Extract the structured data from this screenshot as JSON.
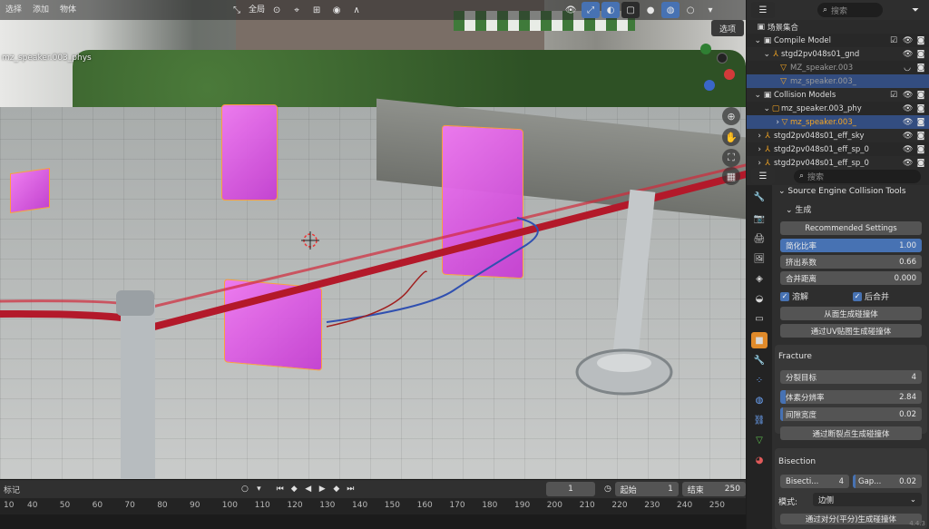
{
  "header": {
    "menu": [
      "选择",
      "添加",
      "物体"
    ],
    "orientation_label": "全局",
    "options_label": "选项"
  },
  "viewport": {
    "object_label": "mz_speaker.003_phys"
  },
  "outliner": {
    "search_placeholder": "搜索",
    "rows": [
      {
        "name": "场景集合",
        "kind": "scene"
      },
      {
        "name": "Compile Model",
        "kind": "collection"
      },
      {
        "name": "stgd2pv048s01_gnd",
        "kind": "object"
      },
      {
        "name": "MZ_speaker.003",
        "kind": "mesh"
      },
      {
        "name": "mz_speaker.003_",
        "kind": "mesh"
      },
      {
        "name": "Collision Models",
        "kind": "collection"
      },
      {
        "name": "mz_speaker.003_phy",
        "kind": "object"
      },
      {
        "name": "mz_speaker.003_",
        "kind": "mesh"
      },
      {
        "name": "stgd2pv048s01_eff_sky",
        "kind": "object"
      },
      {
        "name": "stgd2pv048s01_eff_sp_0",
        "kind": "object"
      },
      {
        "name": "stgd2pv048s01_eff_sp_0",
        "kind": "object"
      }
    ]
  },
  "properties": {
    "search_placeholder": "搜索",
    "panel_title": "Source Engine Collision Tools",
    "generate_label": "生成",
    "recommended_label": "Recommended Settings",
    "simplify": {
      "label": "简化比率",
      "value": "1.00",
      "fraction": 1.0
    },
    "extrude": {
      "label": "挤出系数",
      "value": "0.66"
    },
    "merge": {
      "label": "合并距离",
      "value": "0.000"
    },
    "dissolve_label": "溶解",
    "merge_after_label": "后合并",
    "from_faces_label": "从面生成碰撞体",
    "from_uv_label": "通过UV贴图生成碰撞体",
    "fracture_title": "Fracture",
    "split_target": {
      "label": "分裂目标",
      "value": "4"
    },
    "voxel_res": {
      "label": "体素分辨率",
      "value": "2.84",
      "fraction": 0.04
    },
    "gap_width": {
      "label": "间隙宽度",
      "value": "0.02",
      "fraction": 0.02
    },
    "fracture_btn_label": "通过断裂点生成碰撞体",
    "bisection_title": "Bisection",
    "bisect_field": {
      "label": "Bisecti...",
      "value": "4"
    },
    "gap_field": {
      "label": "Gap...",
      "value": "0.02"
    },
    "mode_label": "模式:",
    "mode_value": "边侧",
    "bottom_partial": "通过对分(平分)生成碰撞体"
  },
  "timeline": {
    "marker_label": "标记",
    "current_frame": "1",
    "start_label": "起始",
    "start_value": "1",
    "end_label": "结束",
    "end_value": "250",
    "ticks": [
      "10",
      "40",
      "50",
      "60",
      "70",
      "80",
      "90",
      "100",
      "110",
      "120",
      "130",
      "140",
      "150",
      "160",
      "170",
      "180",
      "190",
      "200",
      "210",
      "220",
      "230",
      "240",
      "250"
    ]
  },
  "colors": {
    "accent": "#4772b3",
    "collider": "#e96ff0",
    "selection_outline": "#ff9d3b",
    "rope": "#b3192a"
  },
  "status": {
    "version": "4.4.3"
  }
}
